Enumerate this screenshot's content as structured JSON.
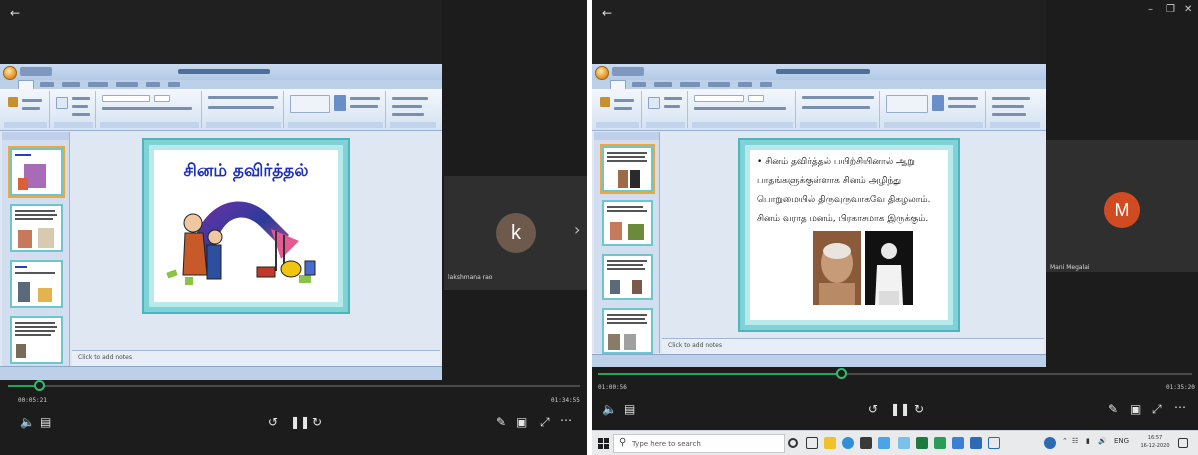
{
  "left_pane": {
    "slide": {
      "title": "சினம் தவிர்த்தல்"
    },
    "notes_placeholder": "Click to add notes",
    "participant": {
      "initial": "k",
      "name": "lakshmana rao",
      "avatar_color": "#6e5a4c"
    },
    "player": {
      "elapsed": "00:05:21",
      "total": "01:34:55",
      "progress_pct": 6
    }
  },
  "right_pane": {
    "slide": {
      "bullet": "•",
      "lines": [
        "சினம் தவிர்த்தல் பயிற்சியினால் ஆறு",
        "பாதங்களுக்குள்ளாக சினம் அழிந்து",
        "பொறுமையில் திருவுருவாகவே திகழலாம்.",
        "சினம் வராத மனம், பிரகாசமாக இருக்கும்."
      ]
    },
    "notes_placeholder": "Click to add notes",
    "participant": {
      "initial": "M",
      "name": "Mani Megalai",
      "avatar_color": "#d14b22"
    },
    "player": {
      "elapsed": "01:00:56",
      "total": "01:35:20",
      "progress_pct": 40
    },
    "taskbar": {
      "search_placeholder": "Type here to search",
      "lang": "ENG",
      "time": "16:57",
      "date": "16-12-2020"
    }
  },
  "colors": {
    "accent": "#1ea65d",
    "slide_border": "#7ed2d8",
    "title_blue": "#1e2fb8"
  }
}
